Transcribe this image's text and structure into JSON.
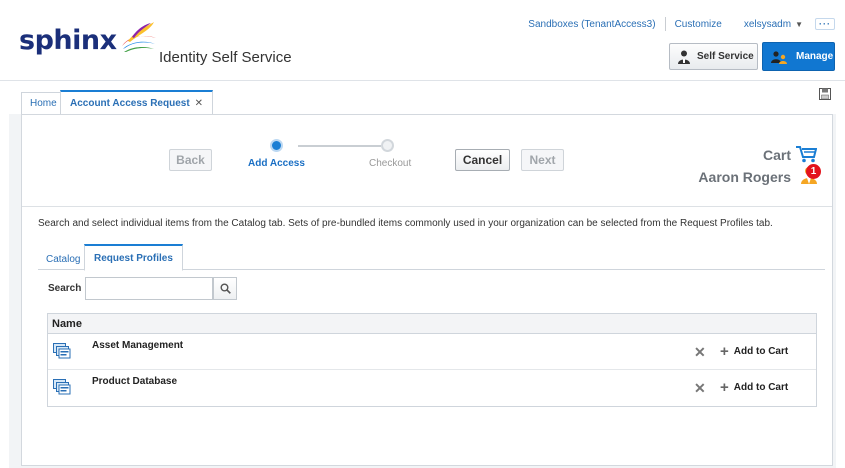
{
  "header": {
    "brand": "sphinx",
    "app_title": "Identity Self Service",
    "links": {
      "sandboxes": "Sandboxes (TenantAccess3)",
      "customize": "Customize",
      "user": "xelsysadm"
    },
    "self_service_label": "Self Service",
    "manage_label": "Manage"
  },
  "tabs": [
    {
      "label": "Home"
    },
    {
      "label": "Account Access Request",
      "active": true
    }
  ],
  "train": {
    "back_label": "Back",
    "cancel_label": "Cancel",
    "next_label": "Next",
    "steps": [
      {
        "label": "Add Access",
        "current": true
      },
      {
        "label": "Checkout",
        "current": false
      }
    ]
  },
  "cart": {
    "label": "Cart",
    "user_name": "Aaron Rogers",
    "badge_count": "1"
  },
  "instructions": "Search and select individual items from the Catalog tab. Sets of pre-bundled items commonly used in your organization can be selected from the Request Profiles tab.",
  "subtabs": [
    {
      "label": "Catalog"
    },
    {
      "label": "Request Profiles",
      "active": true
    }
  ],
  "search": {
    "label": "Search",
    "value": ""
  },
  "table": {
    "header": "Name",
    "add_label": "Add to Cart",
    "rows": [
      {
        "name": "Asset Management"
      },
      {
        "name": "Product Database"
      }
    ]
  },
  "colors": {
    "accent": "#1a7ed4",
    "manage_button": "#1177d1",
    "badge": "#e3141c",
    "brand_text": "#1b2f7a"
  },
  "icons": [
    "logo-swirl",
    "self-service-person-icon",
    "manage-people-icon",
    "save-icon",
    "cart-icon",
    "user-icon",
    "search-icon",
    "request-profile-icon",
    "remove-icon",
    "plus-icon"
  ]
}
